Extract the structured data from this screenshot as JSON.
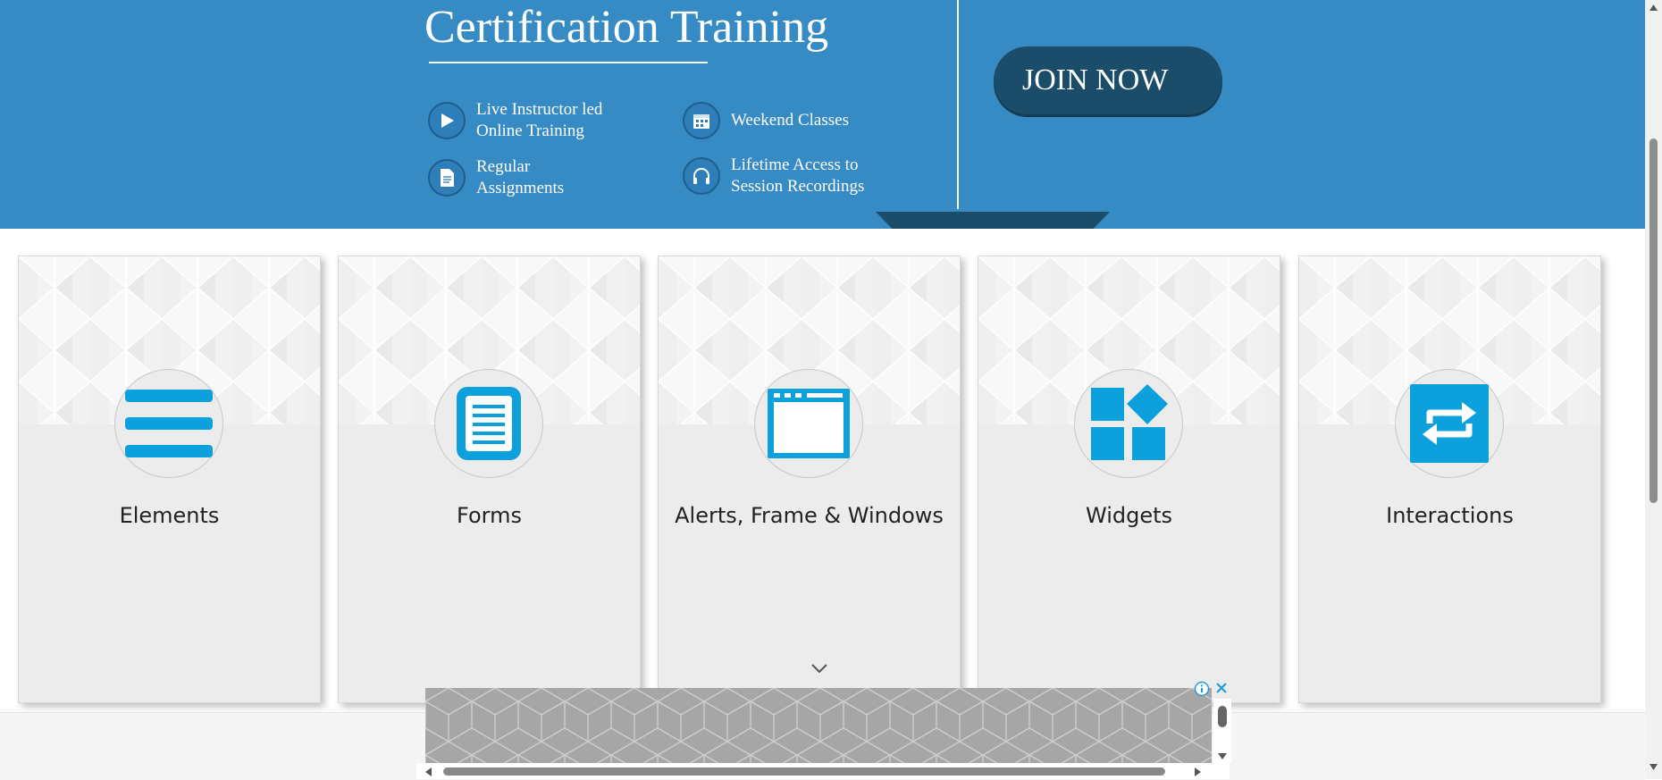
{
  "banner": {
    "title": "Certification Training",
    "features": [
      {
        "icon": "play-icon",
        "line1": "Live Instructor led",
        "line2": "Online Training"
      },
      {
        "icon": "calendar-icon",
        "line1": "Weekend Classes",
        "line2": ""
      },
      {
        "icon": "document-icon",
        "line1": "Regular",
        "line2": "Assignments"
      },
      {
        "icon": "headphones-icon",
        "line1": "Lifetime Access to",
        "line2": "Session Recordings"
      }
    ],
    "join_label": "JOIN NOW",
    "colors": {
      "background": "#378bc4",
      "button": "#1b4d6a"
    }
  },
  "cards": [
    {
      "title": "Elements",
      "icon": "hamburger-list-icon"
    },
    {
      "title": "Forms",
      "icon": "form-document-icon"
    },
    {
      "title": "Alerts, Frame & Windows",
      "icon": "browser-window-icon"
    },
    {
      "title": "Widgets",
      "icon": "widgets-grid-icon"
    },
    {
      "title": "Interactions",
      "icon": "swap-arrows-icon"
    }
  ],
  "accent_color": "#0ca0dd"
}
